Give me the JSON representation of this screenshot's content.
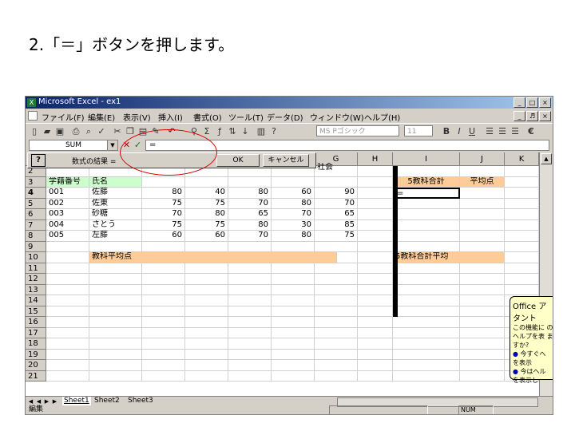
{
  "slide_title": "2.「＝」ボタンを押します。",
  "window": {
    "title": "Microsoft Excel - ex1",
    "app_icon": "X",
    "buttons": [
      "_",
      "□",
      "×"
    ],
    "doc_buttons": [
      "_",
      "♬",
      "×"
    ]
  },
  "menu": [
    "ファイル(F)",
    "編集(E)",
    "表示(V)",
    "挿入(I)",
    "書式(O)",
    "ツール(T)",
    "データ(D)",
    "ウィンドウ(W)",
    "ヘルプ(H)"
  ],
  "toolbar": {
    "font_name": "MS Pゴシック",
    "font_size": "11",
    "bold": "B",
    "italic": "I",
    "underline": "U",
    "currency": "€"
  },
  "formula_bar": {
    "name_box": "SUM",
    "cancel": "✕",
    "enter": "✓",
    "equals": "=",
    "content": "="
  },
  "formula_palette": {
    "help": "?",
    "result_label": "数式の結果 =",
    "ok": "OK",
    "cancel": "キャンセル"
  },
  "columns": [
    "G",
    "H",
    "I",
    "J",
    "K"
  ],
  "rows": [
    "2",
    "3",
    "4",
    "5",
    "6",
    "7",
    "8",
    "9",
    "10",
    "11",
    "12",
    "13",
    "14",
    "15",
    "16",
    "17",
    "18",
    "19",
    "20",
    "21"
  ],
  "col1_header": "社会",
  "table": {
    "header": [
      "学籍番号",
      "氏名"
    ],
    "sum_header": "5教科合計",
    "avg_header": "平均点",
    "records": [
      {
        "id": "001",
        "name": "佐藤",
        "scores": [
          "80",
          "40",
          "80",
          "60",
          "90"
        ]
      },
      {
        "id": "002",
        "name": "佐東",
        "scores": [
          "75",
          "75",
          "70",
          "80",
          "70"
        ]
      },
      {
        "id": "003",
        "name": "砂糖",
        "scores": [
          "70",
          "80",
          "65",
          "70",
          "65"
        ]
      },
      {
        "id": "004",
        "name": "さとう",
        "scores": [
          "75",
          "75",
          "80",
          "30",
          "85"
        ]
      },
      {
        "id": "005",
        "name": "左藤",
        "scores": [
          "60",
          "60",
          "70",
          "80",
          "75"
        ]
      }
    ],
    "active_cell_value": "=",
    "subject_avg_label": "教科平均点",
    "sum_avg_label": "5教科合計平均"
  },
  "assistant": {
    "title": "Office ア",
    "line2": "タント",
    "body": "この機能に のヘルプを表 ますか?",
    "opt1": "今すぐへ を表示",
    "opt2": "今はヘル を表示し"
  },
  "sheets": [
    "Sheet1",
    "Sheet2",
    "Sheet3"
  ],
  "status": {
    "mode": "編集",
    "num": "NUM"
  }
}
